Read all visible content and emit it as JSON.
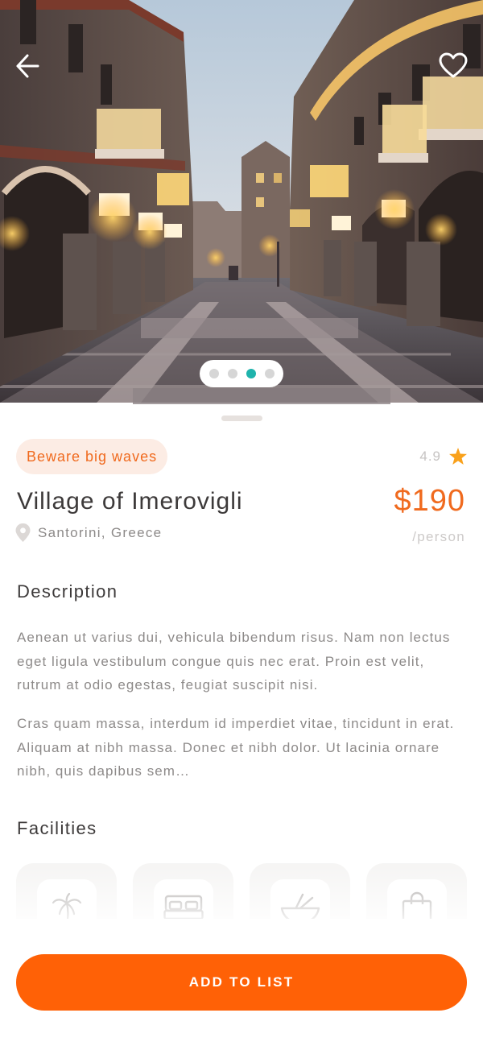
{
  "hero": {
    "carousel": {
      "total": 4,
      "active_index": 2
    }
  },
  "place": {
    "tag": "Beware big waves",
    "rating": "4.9",
    "title": "Village of Imerovigli",
    "price": "$190",
    "price_unit": "/person",
    "location": "Santorini, Greece"
  },
  "description": {
    "heading": "Description",
    "paragraphs": [
      "Aenean ut varius dui, vehicula bibendum risus. Nam non lectus eget ligula vestibulum congue quis nec erat. Proin est velit, rutrum at odio egestas, feugiat suscipit nisi.",
      "Cras quam massa, interdum id imperdiet vitae, tincidunt in erat. Aliquam at nibh massa. Donec et nibh dolor. Ut lacinia ornare nibh, quis dapibus sem…"
    ]
  },
  "facilities": {
    "heading": "Facilities",
    "items": [
      {
        "icon": "palm-tree-icon"
      },
      {
        "icon": "bed-icon"
      },
      {
        "icon": "food-bowl-icon"
      },
      {
        "icon": "shopping-bag-icon"
      }
    ]
  },
  "footer": {
    "cta_label": "ADD TO LIST"
  },
  "colors": {
    "accent": "#ff6106",
    "tag_bg": "#fcece4",
    "star": "#f9a11b",
    "carousel_active": "#1fb3ac"
  }
}
